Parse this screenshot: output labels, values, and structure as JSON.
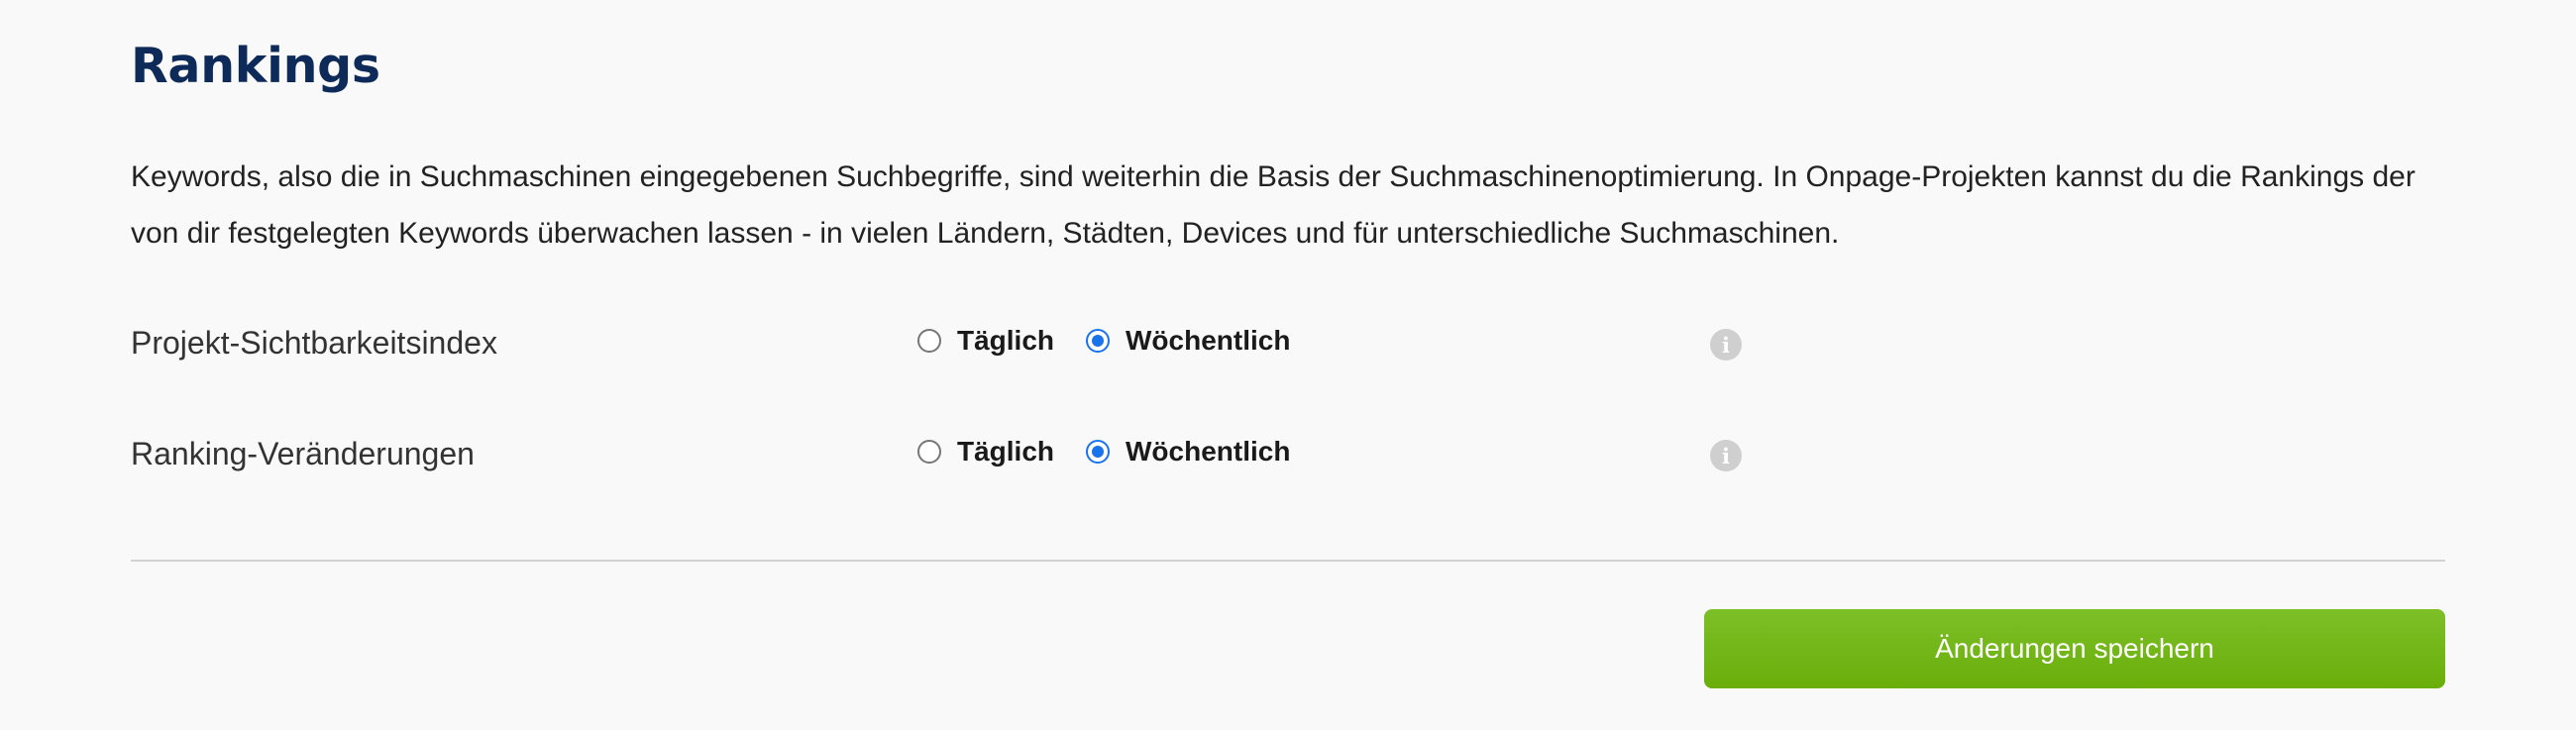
{
  "section": {
    "title": "Rankings",
    "intro": "Keywords, also die in Suchmaschinen eingegebenen Suchbegriffe, sind weiterhin die Basis der Suchmaschinenoptimierung. In Onpage-Projekten kannst du die Rankings der von dir festgelegten Keywords überwachen lassen - in vielen Ländern, Städten, Devices und für unterschiedliche Suchmaschinen."
  },
  "settings": [
    {
      "label": "Projekt-Sichtbarkeitsindex",
      "options": [
        "Täglich",
        "Wöchentlich"
      ],
      "selected": "Wöchentlich"
    },
    {
      "label": "Ranking-Veränderungen",
      "options": [
        "Täglich",
        "Wöchentlich"
      ],
      "selected": "Wöchentlich"
    }
  ],
  "icons": {
    "info": "info-icon",
    "info_glyph": "i"
  },
  "actions": {
    "save_label": "Änderungen speichern"
  },
  "colors": {
    "title": "#0d2a58",
    "accent_radio": "#1a73e8",
    "save_button": "#6aae0b",
    "background": "#f9f9fa"
  }
}
